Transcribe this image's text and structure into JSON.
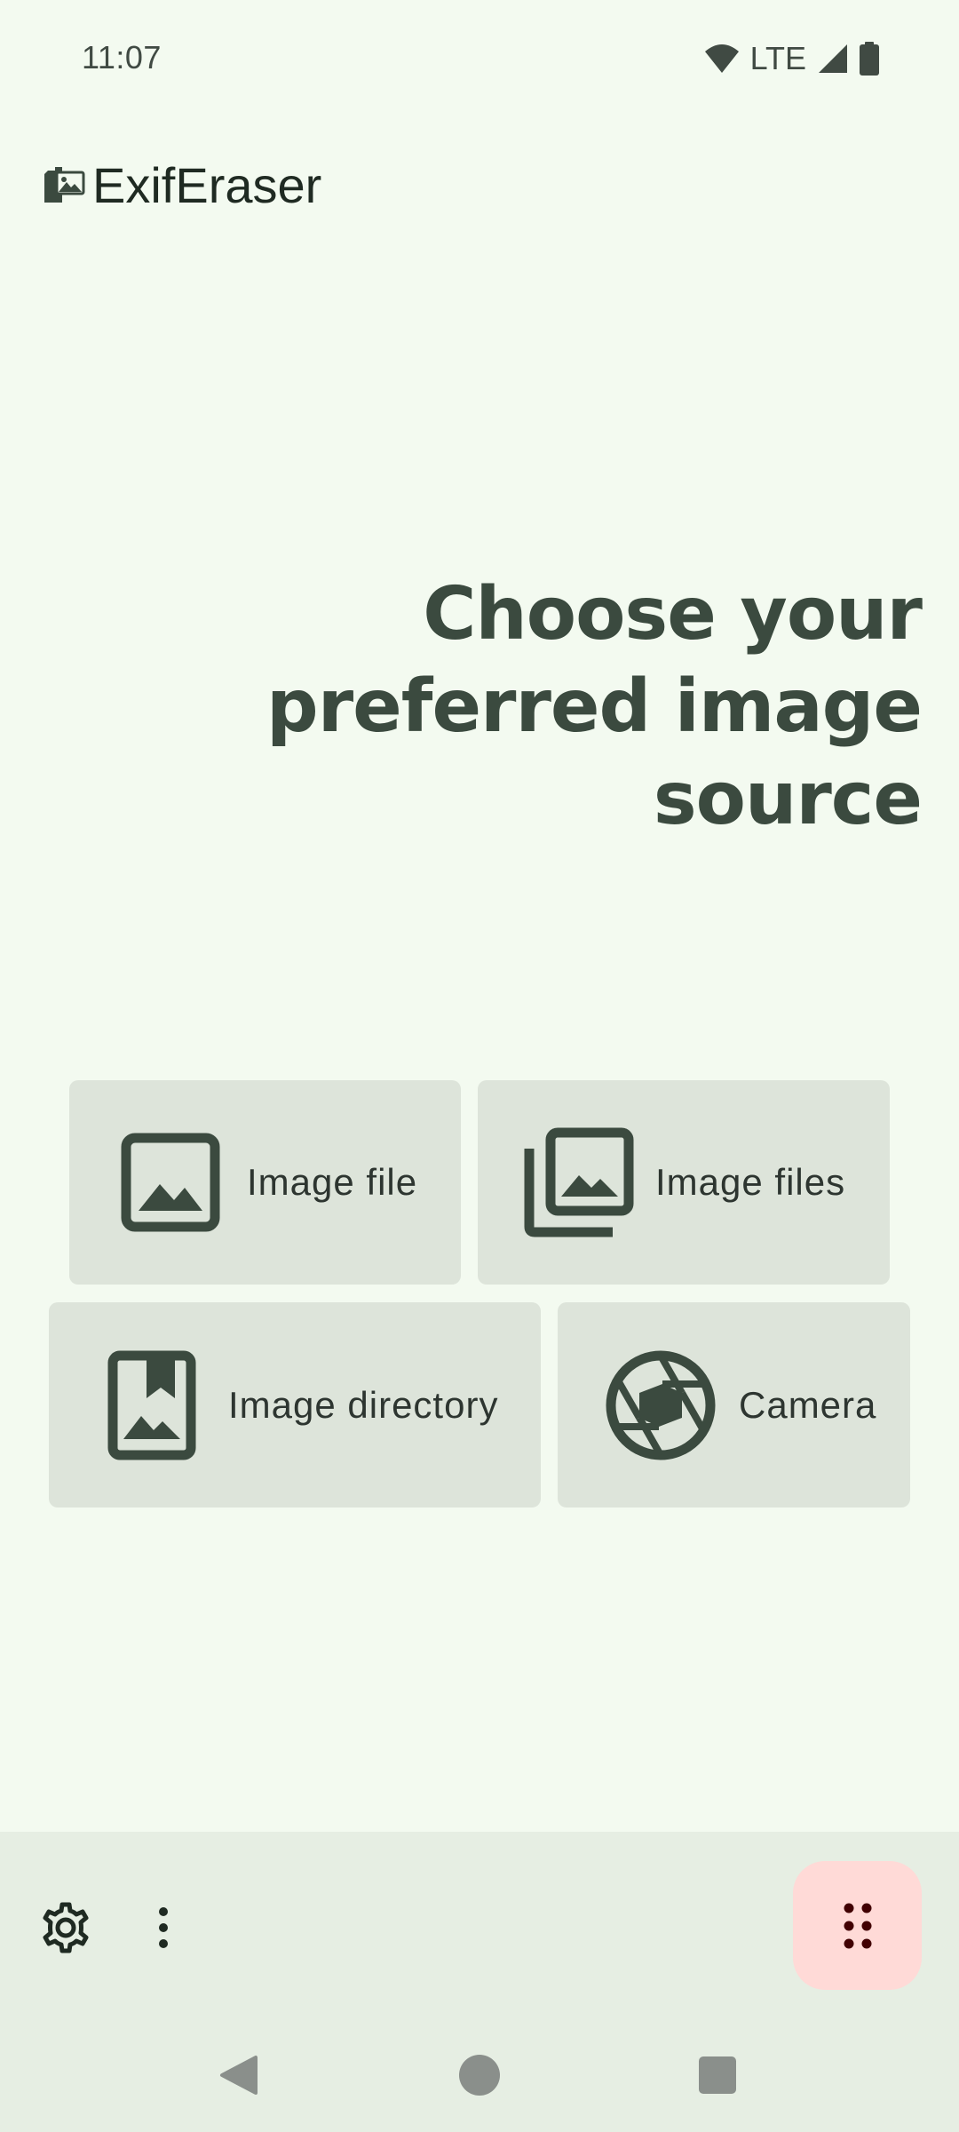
{
  "status_bar": {
    "time": "11:07",
    "network": "LTE",
    "icons": [
      "wifi-icon",
      "cell-signal-icon",
      "battery-icon"
    ]
  },
  "app_bar": {
    "title": "ExifEraser",
    "logo_icon": "exif-eraser-logo-icon"
  },
  "main": {
    "heading": "Choose your preferred image source",
    "sources": [
      {
        "label": "Image file",
        "icon": "image-icon"
      },
      {
        "label": "Image files",
        "icon": "image-stack-icon"
      },
      {
        "label": "Image directory",
        "icon": "image-folder-icon"
      },
      {
        "label": "Camera",
        "icon": "camera-shutter-icon"
      }
    ]
  },
  "bottom_bar": {
    "actions": [
      "settings-icon",
      "more-vert-icon"
    ],
    "fab_icon": "drag-handle-icon"
  },
  "nav_bar": {
    "buttons": [
      "back-icon",
      "home-icon",
      "recents-icon"
    ]
  },
  "colors": {
    "background": "#f3faf0",
    "card": "#dde4da",
    "foreground": "#3b4a3f",
    "bottom_bar": "#e6eee3",
    "fab": "#ffdad7",
    "fab_icon": "#410002"
  }
}
